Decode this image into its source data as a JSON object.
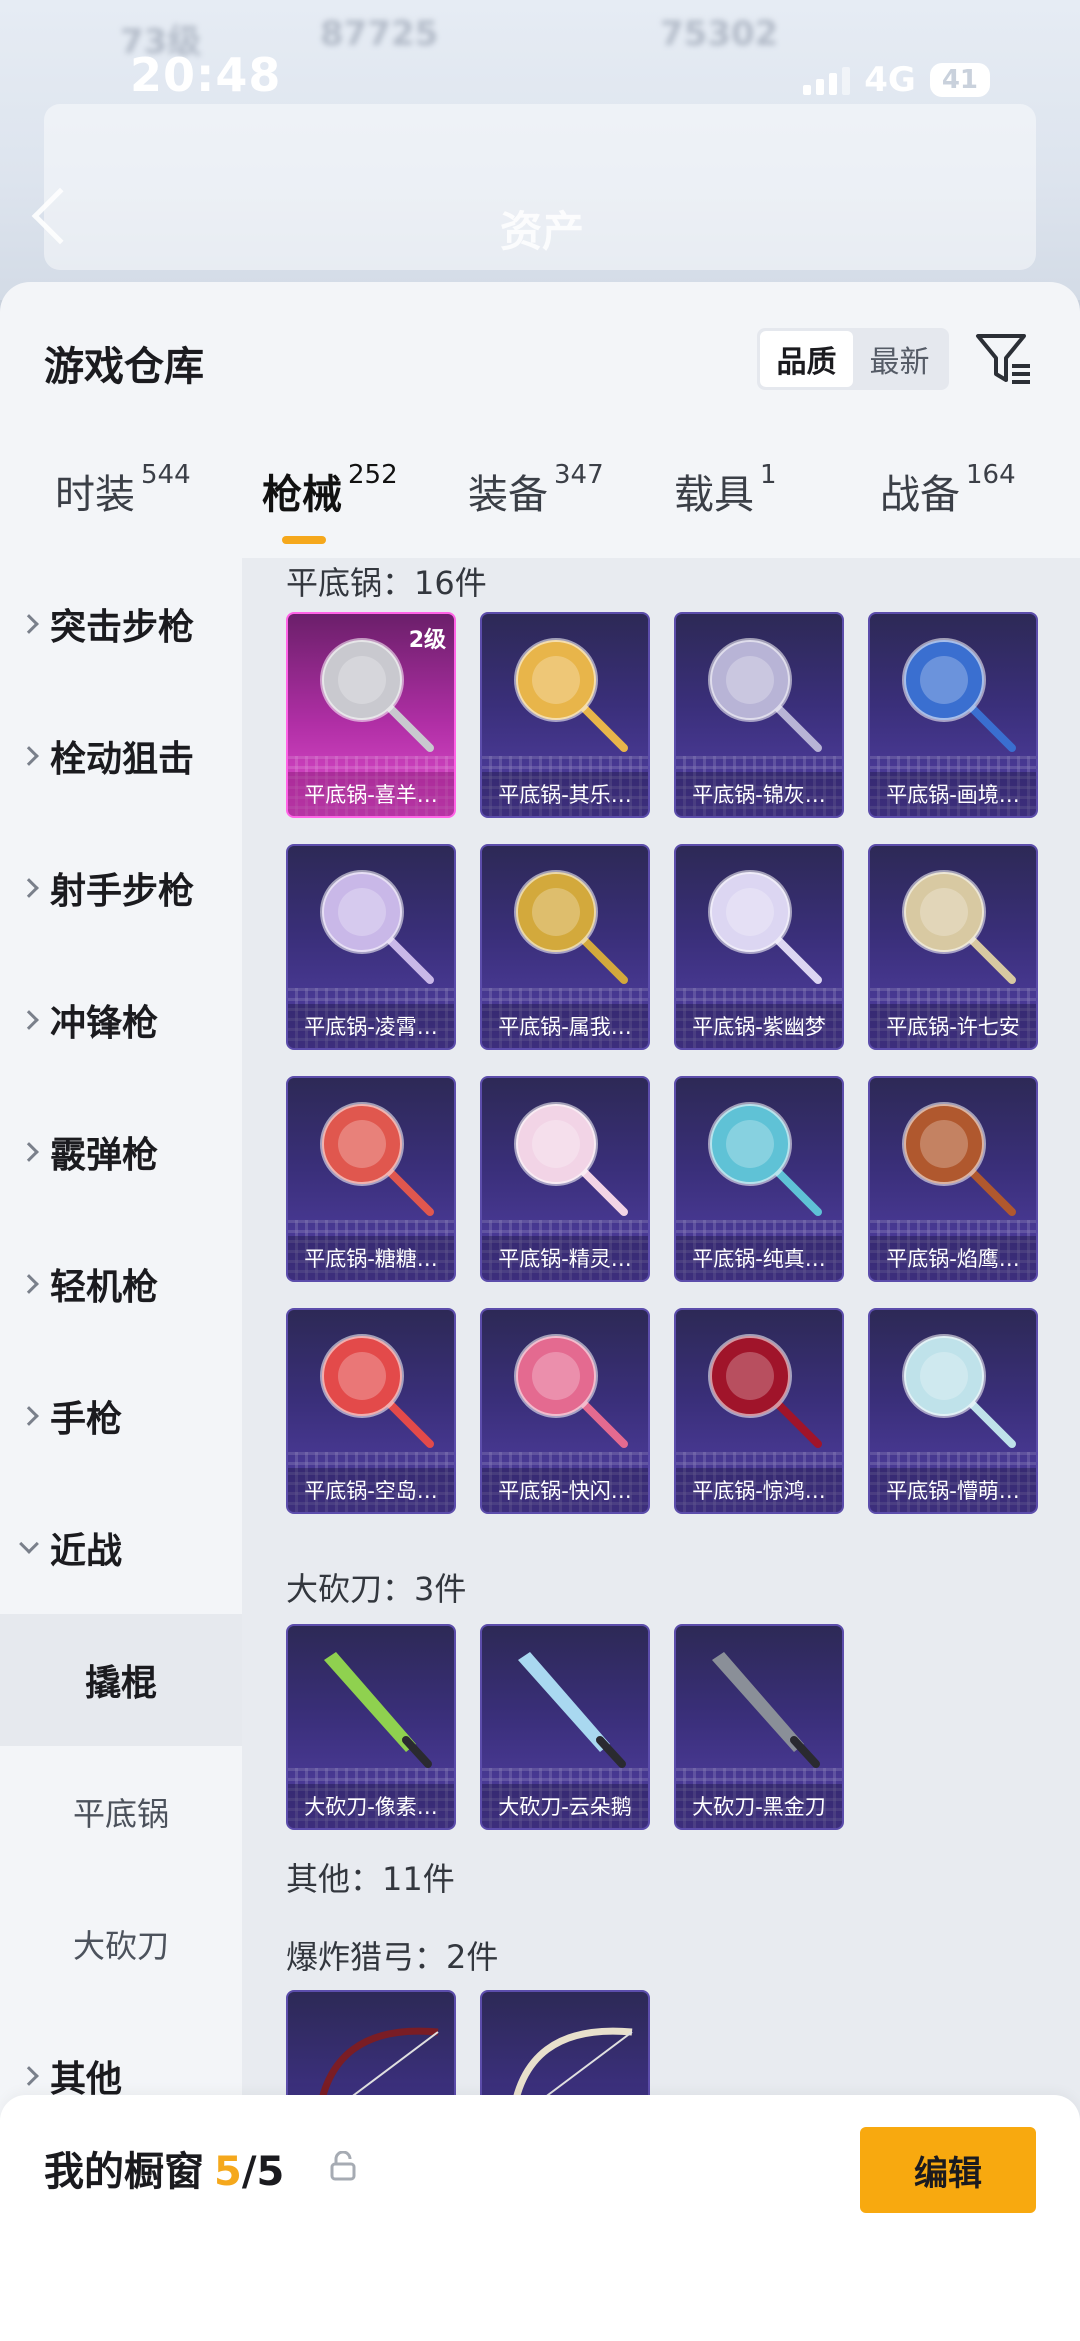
{
  "status_bar": {
    "time": "20:48",
    "network": "4G",
    "battery": "41"
  },
  "header": {
    "title": "资产",
    "blurred_level": "73级",
    "blurred_coins": "87725",
    "blurred_points": "75302"
  },
  "sheet": {
    "title": "游戏仓库",
    "sort_options": [
      "品质",
      "最新"
    ],
    "sort_active": "品质"
  },
  "tabs": [
    {
      "label": "时装",
      "count": "544"
    },
    {
      "label": "枪械",
      "count": "252",
      "active": true
    },
    {
      "label": "装备",
      "count": "347"
    },
    {
      "label": "载具",
      "count": "1"
    },
    {
      "label": "战备",
      "count": "164"
    }
  ],
  "sidebar": {
    "categories": [
      "突击步枪",
      "栓动狙击",
      "射手步枪",
      "冲锋枪",
      "霰弹枪",
      "轻机枪",
      "手枪",
      "近战"
    ],
    "expanded": "近战",
    "subitems": [
      "撬棍",
      "平底锅",
      "大砍刀"
    ],
    "sub_active": "撬棍",
    "after": "其他"
  },
  "sections": [
    {
      "title": "平底锅：16件",
      "items": [
        {
          "name": "平底锅-喜羊…",
          "level": "2级",
          "rarity": "gold",
          "color": "#c9c9cf"
        },
        {
          "name": "平底锅-其乐…",
          "color": "#e8b54a"
        },
        {
          "name": "平底锅-锦灰…",
          "color": "#b8b4d6"
        },
        {
          "name": "平底锅-画境…",
          "color": "#3a6fd0"
        },
        {
          "name": "平底锅-凌霄…",
          "color": "#c9b8e8"
        },
        {
          "name": "平底锅-属我…",
          "color": "#d3a93c"
        },
        {
          "name": "平底锅-紫幽梦",
          "color": "#dcd6f2"
        },
        {
          "name": "平底锅-许七安",
          "color": "#d8c9a2"
        },
        {
          "name": "平底锅-糖糖…",
          "color": "#e0574e"
        },
        {
          "name": "平底锅-精灵…",
          "color": "#f2d4e6"
        },
        {
          "name": "平底锅-纯真…",
          "color": "#5fc2d6"
        },
        {
          "name": "平底锅-焰鹰…",
          "color": "#b0582e"
        },
        {
          "name": "平底锅-空岛…",
          "color": "#e34a4a"
        },
        {
          "name": "平底锅-快闪…",
          "color": "#e46a90"
        },
        {
          "name": "平底锅-惊鸿…",
          "color": "#a0142a"
        },
        {
          "name": "平底锅-懵萌…",
          "color": "#bfe2ea"
        }
      ]
    },
    {
      "title": "大砍刀：3件",
      "items": [
        {
          "name": "大砍刀-像素…",
          "color": "#8fd14f"
        },
        {
          "name": "大砍刀-云朵鹅",
          "color": "#a9d8f0"
        },
        {
          "name": "大砍刀-黑金刀",
          "color": "#8a8f98"
        }
      ]
    },
    {
      "title": "其他：11件",
      "items": []
    },
    {
      "title": "爆炸猎弓：2件",
      "items": [
        {
          "name": "",
          "color": "#7a1d25"
        },
        {
          "name": "",
          "color": "#e8e0cc"
        }
      ]
    }
  ],
  "bottom_bar": {
    "title": "我的橱窗",
    "count": "5",
    "total": "/5",
    "edit_label": "编辑"
  },
  "colors": {
    "accent": "#f8a90f",
    "card_purple": "#3a2f7a",
    "card_gold": "#b12fa6"
  }
}
